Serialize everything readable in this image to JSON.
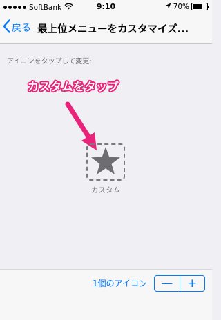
{
  "status_bar": {
    "carrier": "SoftBank",
    "time": "9:10",
    "battery_percent": "70%",
    "battery_level": 0.7
  },
  "nav": {
    "back_label": "戻る",
    "title": "最上位メニューをカスタマイズ..."
  },
  "main": {
    "instruction": "アイコンをタップして変更:",
    "annotation": "カスタムをタップ",
    "annotation_color": "#e8247a",
    "icon": {
      "name": "star-icon",
      "label": "カスタム"
    }
  },
  "toolbar": {
    "count_label": "1個のアイコン",
    "minus": "—",
    "plus": "+"
  },
  "colors": {
    "accent": "#007aff",
    "background": "#efeff4",
    "icon_gray": "#7a7a7e"
  }
}
